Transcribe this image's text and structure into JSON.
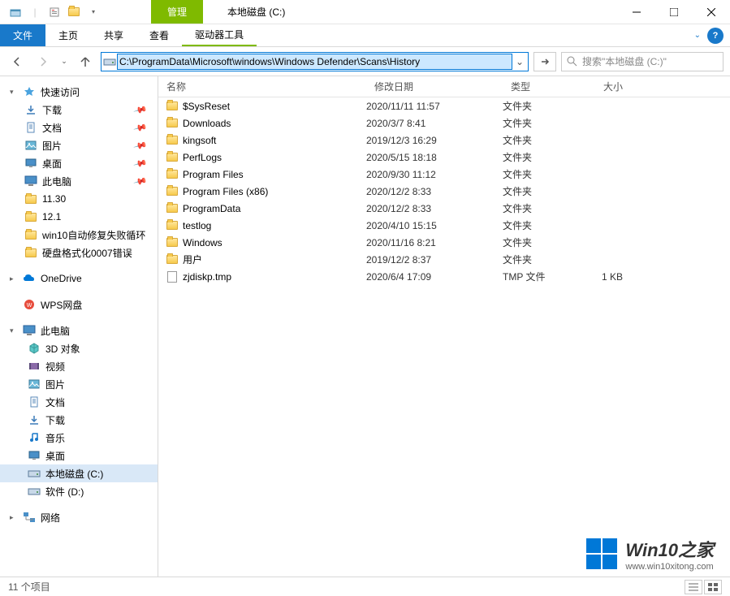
{
  "title": "本地磁盘 (C:)",
  "context_tab_group": "管理",
  "ribbon": {
    "file": "文件",
    "home": "主页",
    "share": "共享",
    "view": "查看",
    "drive_tools": "驱动器工具"
  },
  "address_path": "C:\\ProgramData\\Microsoft\\windows\\Windows Defender\\Scans\\History",
  "search_placeholder": "搜索\"本地磁盘 (C:)\"",
  "columns": {
    "name": "名称",
    "date": "修改日期",
    "type": "类型",
    "size": "大小"
  },
  "sidebar": {
    "quick_access": "快速访问",
    "quick_items": [
      {
        "label": "下载",
        "pinned": true,
        "kind": "download"
      },
      {
        "label": "文档",
        "pinned": true,
        "kind": "doc"
      },
      {
        "label": "图片",
        "pinned": true,
        "kind": "pic"
      },
      {
        "label": "桌面",
        "pinned": true,
        "kind": "desktop"
      },
      {
        "label": "此电脑",
        "pinned": true,
        "kind": "pc"
      },
      {
        "label": "11.30",
        "pinned": false,
        "kind": "folder"
      },
      {
        "label": "12.1",
        "pinned": false,
        "kind": "folder"
      },
      {
        "label": "win10自动修复失败循环",
        "pinned": false,
        "kind": "folder"
      },
      {
        "label": "硬盘格式化0007错误",
        "pinned": false,
        "kind": "folder"
      }
    ],
    "onedrive": "OneDrive",
    "wps": "WPS网盘",
    "this_pc": "此电脑",
    "pc_items": [
      {
        "label": "3D 对象",
        "kind": "3d"
      },
      {
        "label": "视频",
        "kind": "video"
      },
      {
        "label": "图片",
        "kind": "pic"
      },
      {
        "label": "文档",
        "kind": "doc"
      },
      {
        "label": "下载",
        "kind": "download"
      },
      {
        "label": "音乐",
        "kind": "music"
      },
      {
        "label": "桌面",
        "kind": "desktop"
      },
      {
        "label": "本地磁盘 (C:)",
        "kind": "drive",
        "selected": true
      },
      {
        "label": "软件 (D:)",
        "kind": "drive"
      }
    ],
    "network": "网络"
  },
  "files": [
    {
      "name": "$SysReset",
      "date": "2020/11/11 11:57",
      "type": "文件夹",
      "size": "",
      "kind": "folder"
    },
    {
      "name": "Downloads",
      "date": "2020/3/7 8:41",
      "type": "文件夹",
      "size": "",
      "kind": "folder"
    },
    {
      "name": "kingsoft",
      "date": "2019/12/3 16:29",
      "type": "文件夹",
      "size": "",
      "kind": "folder"
    },
    {
      "name": "PerfLogs",
      "date": "2020/5/15 18:18",
      "type": "文件夹",
      "size": "",
      "kind": "folder"
    },
    {
      "name": "Program Files",
      "date": "2020/9/30 11:12",
      "type": "文件夹",
      "size": "",
      "kind": "folder"
    },
    {
      "name": "Program Files (x86)",
      "date": "2020/12/2 8:33",
      "type": "文件夹",
      "size": "",
      "kind": "folder"
    },
    {
      "name": "ProgramData",
      "date": "2020/12/2 8:33",
      "type": "文件夹",
      "size": "",
      "kind": "folder"
    },
    {
      "name": "testlog",
      "date": "2020/4/10 15:15",
      "type": "文件夹",
      "size": "",
      "kind": "folder"
    },
    {
      "name": "Windows",
      "date": "2020/11/16 8:21",
      "type": "文件夹",
      "size": "",
      "kind": "folder"
    },
    {
      "name": "用户",
      "date": "2019/12/2 8:37",
      "type": "文件夹",
      "size": "",
      "kind": "folder"
    },
    {
      "name": "zjdiskp.tmp",
      "date": "2020/6/4 17:09",
      "type": "TMP 文件",
      "size": "1 KB",
      "kind": "file"
    }
  ],
  "status": "11 个项目",
  "watermark": {
    "brand": "Win10之家",
    "url": "www.win10xitong.com"
  }
}
